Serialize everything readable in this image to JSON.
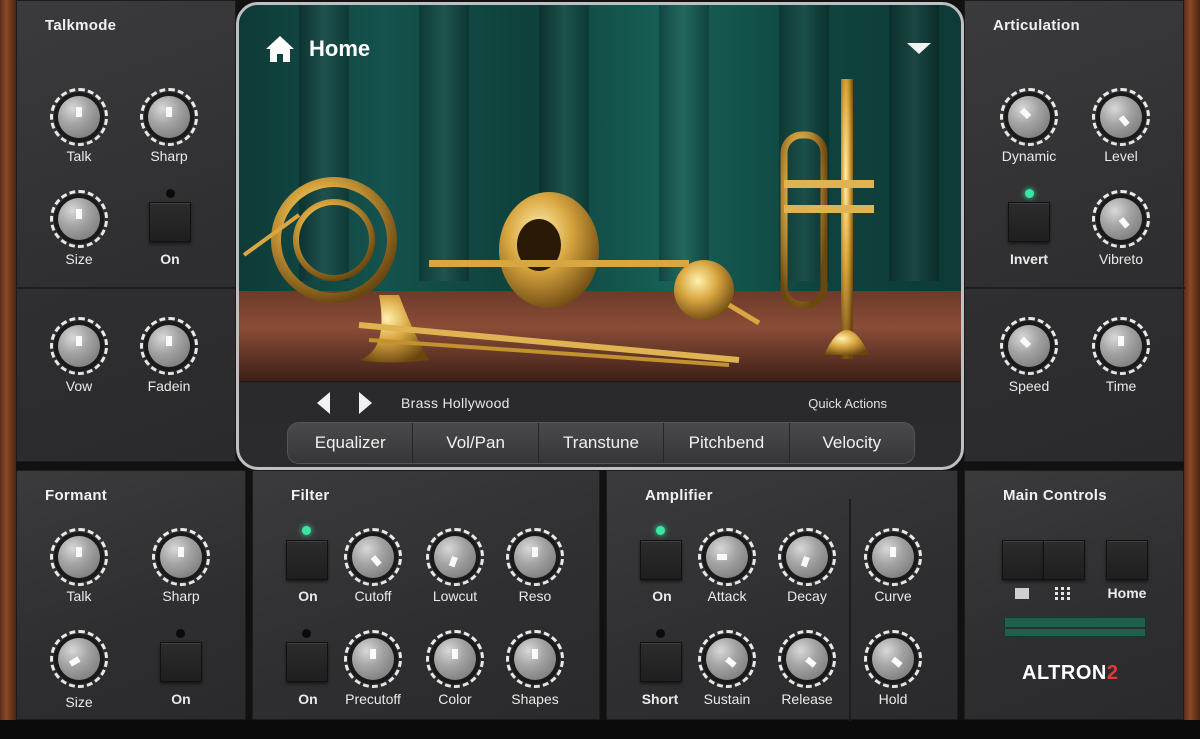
{
  "talkmode": {
    "title": "Talkmode",
    "talk": "Talk",
    "sharp": "Sharp",
    "size": "Size",
    "on": "On",
    "vow": "Vow",
    "fadein": "Fadein"
  },
  "articulation": {
    "title": "Articulation",
    "dynamic": "Dynamic",
    "level": "Level",
    "invert": "Invert",
    "vibreto": "Vibreto",
    "speed": "Speed",
    "time": "Time"
  },
  "display": {
    "home": "Home",
    "preset": "Brass Hollywood",
    "quick_actions": "Quick Actions",
    "tabs": [
      "Equalizer",
      "Vol/Pan",
      "Transtune",
      "Pitchbend",
      "Velocity"
    ]
  },
  "formant": {
    "title": "Formant",
    "talk": "Talk",
    "sharp": "Sharp",
    "size": "Size",
    "on": "On"
  },
  "filter": {
    "title": "Filter",
    "on1": "On",
    "cutoff": "Cutoff",
    "lowcut": "Lowcut",
    "reso": "Reso",
    "on2": "On",
    "precutoff": "Precutoff",
    "color": "Color",
    "shapes": "Shapes"
  },
  "amplifier": {
    "title": "Amplifier",
    "on": "On",
    "attack": "Attack",
    "decay": "Decay",
    "curve": "Curve",
    "short": "Short",
    "sustain": "Sustain",
    "release": "Release",
    "hold": "Hold"
  },
  "main_controls": {
    "title": "Main Controls",
    "home": "Home",
    "logo_main": "ALTRON",
    "logo_num": "2"
  },
  "colors": {
    "led_on": "#39e6a4",
    "meter": "#1e5f4e",
    "logo_accent": "#e23a3a"
  },
  "icons": [
    "home-icon",
    "dropdown-arrow-icon",
    "prev-arrow-icon",
    "next-arrow-icon",
    "folder-icon",
    "grid-icon"
  ]
}
